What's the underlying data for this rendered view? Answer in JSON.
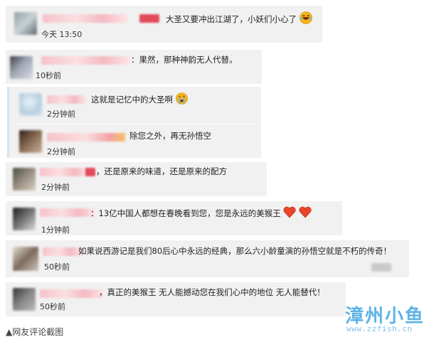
{
  "comments": [
    {
      "text": "大圣又要冲出江湖了，小妖们小心了",
      "time": "今天 13:50",
      "emoji": "laugh-cry-emoji"
    },
    {
      "text": "：果然，那种神韵无人代替。",
      "time": "10秒前"
    },
    {
      "text": "这就是记忆中的大圣啊",
      "time": "2分钟前",
      "emoji": "crying-emoji"
    },
    {
      "text": "除您之外，再无孙悟空",
      "time": "2分钟前"
    },
    {
      "text": "，还是原来的味道，还是原来的配方",
      "time": "2分钟前"
    },
    {
      "text": "：13亿中国人都想在春晚看到您，您是永远的美猴王",
      "time": "1分钟前",
      "emoji": "two-hearts-emoji"
    },
    {
      "text": "如果说西游记是我们80后心中永远的经典，那么六小龄童演的孙悟空就是不朽的传奇！",
      "time": "50秒前"
    },
    {
      "text": "，真正的美猴王 无人能撼动您在我们心中的地位 无人能替代！",
      "time": "50秒前"
    }
  ],
  "watermark": {
    "title": "漳州小鱼",
    "url": "www.zzfish.cn",
    "color": "#5db3e6"
  },
  "caption": "▲网友评论截图",
  "colors": {
    "card_bg": "#f1f1f1",
    "reply_bar": "#d6e3ef",
    "heart": "#e8452c"
  }
}
